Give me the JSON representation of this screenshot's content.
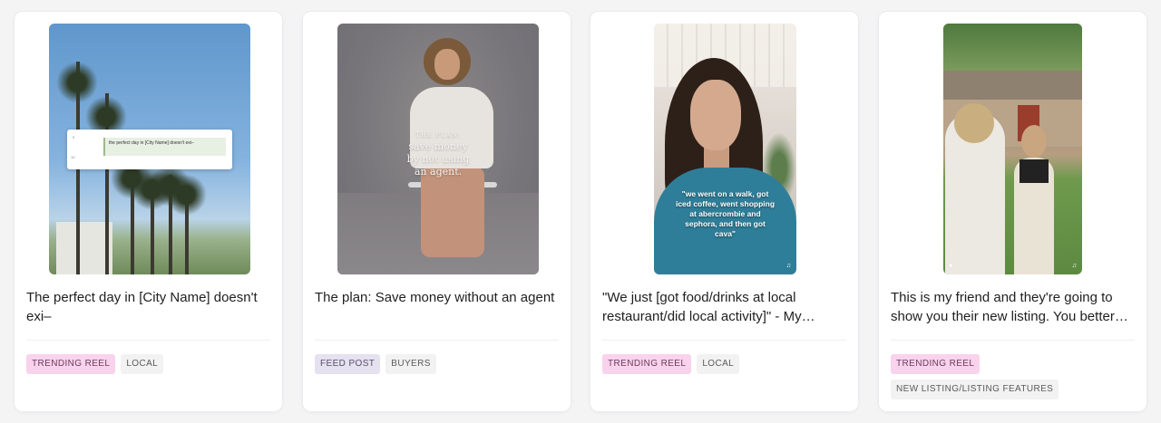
{
  "cards": [
    {
      "title": "The perfect day in [City Name] doesn't exi–",
      "thumbnail": {
        "popup_row_1": "9",
        "popup_row_2": "10",
        "popup_text": "the perfect day in [City Name] doesn't exi–"
      },
      "tags": [
        "TRENDING REEL",
        "LOCAL"
      ]
    },
    {
      "title": "The plan: Save money without an agent",
      "thumbnail": {
        "overlay_kicker": "THE PLAN:",
        "overlay_text": "save money by not using an agent."
      },
      "tags": [
        "FEED POST",
        "BUYERS"
      ]
    },
    {
      "title": "\"We just [got food/drinks at local restaurant/did local activity]\" - My dream...",
      "thumbnail": {
        "overlay_text": "\"we went on a walk, got iced coffee, went shopping at abercrombie and sephora, and then got cava\""
      },
      "tags": [
        "TRENDING REEL",
        "LOCAL"
      ]
    },
    {
      "title": "This is my friend and they're going to show you their new listing. You better s...",
      "thumbnail": {},
      "tags": [
        "TRENDING REEL",
        "NEW LISTING/LISTING FEATURES"
      ]
    }
  ],
  "tag_colors": {
    "TRENDING REEL": "#f9d3ec",
    "FEED POST": "#e6e1ee",
    "default": "#f2f2f3"
  },
  "icons": {
    "volume": "volume-icon",
    "person": "person-icon"
  }
}
